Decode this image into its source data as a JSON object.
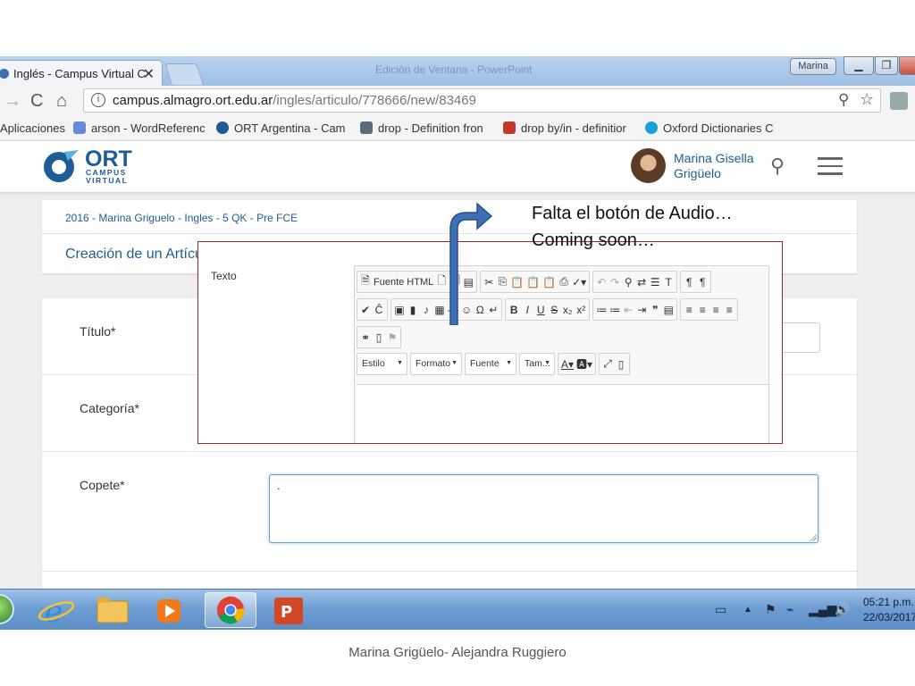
{
  "browser": {
    "tab_title": "Inglés - Campus Virtual C",
    "tab_close": "✕",
    "window_title": "Edición de Ventana - PowerPoint",
    "user_chip": "Marina",
    "url_host": "campus.almagro.ort.edu.ar",
    "url_path": "/ingles/articulo/778666/new/83469",
    "bookmarks": [
      {
        "label": "Aplicaciones",
        "icon_color": "#4285f4"
      },
      {
        "label": "arson - WordReferenc",
        "icon_color": "#6a8bd4"
      },
      {
        "label": "ORT Argentina - Cam",
        "icon_color": "#1e5c96"
      },
      {
        "label": "drop - Definition fron",
        "icon_color": "#5a6b7c"
      },
      {
        "label": "drop by/in - definitior",
        "icon_color": "#c0392b"
      },
      {
        "label": "Oxford Dictionaries C",
        "icon_color": "#1a9fd6"
      }
    ]
  },
  "site": {
    "logo_title": "ORT",
    "logo_sub1": "CAMPUS",
    "logo_sub2": "VIRTUAL",
    "user_first": "Marina Gisella",
    "user_last": "Grigüelo",
    "breadcrumb": "2016 - Marina Griguelo - Ingles - 5 QK - Pre FCE",
    "section_title": "Creación de un Artículo",
    "labels": {
      "titulo": "Título*",
      "categoria": "Categoría*",
      "copete": "Copete*"
    },
    "copete_value": "."
  },
  "editor": {
    "texto_label": "Texto",
    "source_button": "Fuente HTML",
    "combo_estilo": "Estilo",
    "combo_formato": "Formato",
    "combo_fuente": "Fuente",
    "combo_tamano": "Tam..."
  },
  "annotation": {
    "line1": "Falta el botón de Audio…",
    "line2": "Coming soon…"
  },
  "taskbar": {
    "time": "05:21 p.m.",
    "date": "22/03/2017"
  },
  "footer": "Marina Grigüelo- Alejandra Ruggiero"
}
